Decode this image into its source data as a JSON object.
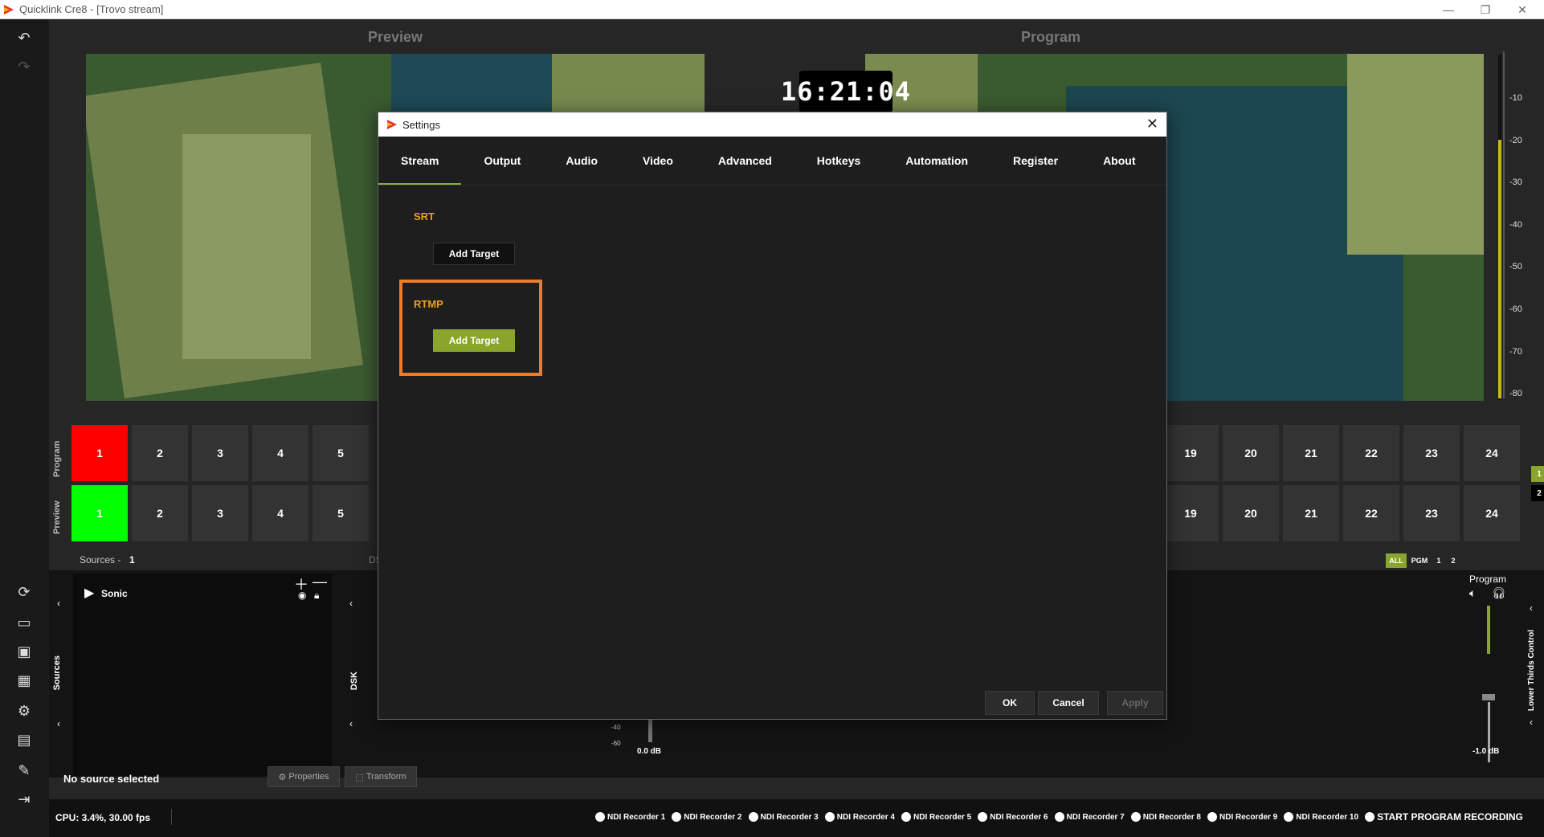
{
  "window": {
    "title": "Quicklink Cre8  - [Trovo stream]",
    "minimize": "—",
    "restore": "❐",
    "close": "✕"
  },
  "header": {
    "preview_title": "Preview",
    "program_title": "Program",
    "clock": "16:21:04"
  },
  "vu_ticks": [
    "-10",
    "-20",
    "-30",
    "-40",
    "-50",
    "-60",
    "-70",
    "-80"
  ],
  "grid": {
    "program_label": "Program",
    "preview_label": "Preview",
    "left_cells": [
      "1",
      "2",
      "3",
      "4",
      "5"
    ],
    "right_cells": [
      "19",
      "20",
      "21",
      "22",
      "23",
      "24"
    ],
    "page_indicators": [
      "1",
      "2"
    ]
  },
  "sources": {
    "label": "Sources -",
    "count": "1",
    "items": [
      {
        "name": "Sonic"
      }
    ],
    "vertical_label": "Sources",
    "dsk_label": "DSK",
    "dsk_header": "DS"
  },
  "audio": {
    "filters": [
      "ALL",
      "PGM",
      "1",
      "2"
    ],
    "program_label": "Program",
    "left_db": "0.0 dB",
    "right_db": "-1.0 dB",
    "scale": [
      "-40",
      "-60"
    ],
    "lower_thirds": "Lower Thirds Control"
  },
  "selection": {
    "no_source": "No source selected",
    "properties": "Properties",
    "transform": "Transform"
  },
  "status": {
    "cpu": "CPU: 3.4%, 30.00 fps",
    "recorders": [
      "NDI Recorder 1",
      "NDI Recorder 2",
      "NDI Recorder 3",
      "NDI Recorder 4",
      "NDI Recorder 5",
      "NDI Recorder 6",
      "NDI Recorder 7",
      "NDI Recorder 8",
      "NDI Recorder 9",
      "NDI Recorder 10"
    ],
    "start_recording": "START PROGRAM RECORDING"
  },
  "dialog": {
    "title": "Settings",
    "tabs": [
      "Stream",
      "Output",
      "Audio",
      "Video",
      "Advanced",
      "Hotkeys",
      "Automation",
      "Register",
      "About"
    ],
    "active_tab": "Stream",
    "srt_label": "SRT",
    "rtmp_label": "RTMP",
    "add_target": "Add Target",
    "ok": "OK",
    "cancel": "Cancel",
    "apply": "Apply"
  },
  "colors": {
    "accent": "#8aa52b",
    "highlight": "#f07a25",
    "program_red": "#ff0000",
    "preview_green": "#00ff00",
    "section_orange": "#e8a020"
  }
}
